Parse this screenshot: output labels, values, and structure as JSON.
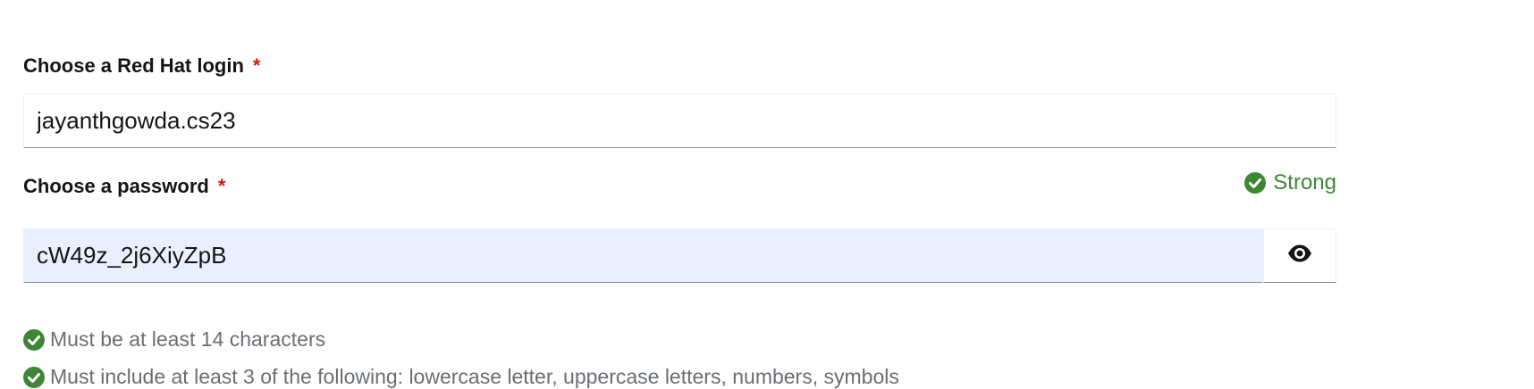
{
  "login_field": {
    "label": "Choose a Red Hat login",
    "required_marker": "*",
    "value": "jayanthgowda.cs23"
  },
  "password_field": {
    "label": "Choose a password",
    "required_marker": "*",
    "value": "cW49z_2j6XiyZpB",
    "strength_label": "Strong",
    "toggle_icon": "eye-icon"
  },
  "requirements": [
    {
      "text": "Must be at least 14 characters",
      "met": true
    },
    {
      "text": "Must include at least 3 of the following: lowercase letter, uppercase letters, numbers, symbols",
      "met": true
    }
  ],
  "colors": {
    "required": "#c9190b",
    "success": "#3e8635",
    "autofill_background": "#e8f0fe",
    "helper_text": "#6a6e73"
  }
}
